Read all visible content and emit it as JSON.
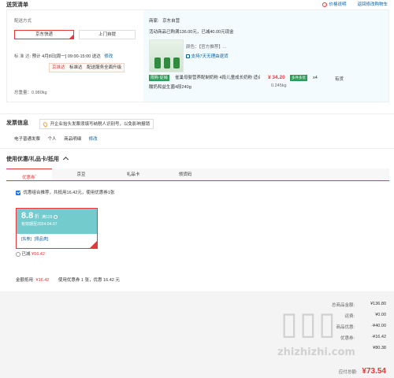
{
  "header": {
    "title": "送货清单",
    "links": [
      "价格说明",
      "返回修改购物车"
    ]
  },
  "delivery": {
    "method_label": "配送方式",
    "options": [
      "京东快递",
      "上门自提"
    ],
    "time_label": "标 准 达:",
    "time_value": "预计 4月8日[周一] 09:00-15:00 送达",
    "time_edit": "修改",
    "upgrade_badge": "京准达",
    "upgrade_text": "标准达",
    "upgrade_action": "配送服务全面升级",
    "weight_label": "总重量：",
    "weight_value": "0.980kg"
  },
  "merchant": {
    "label": "商家:",
    "name": "京东自营",
    "promo": "活动商品已购满136.00元，已减40.00元现金",
    "color_label": "颜色：",
    "color_value": "【官方推荐】...",
    "service": "支持7天无理由退货",
    "tag": "限购·促销",
    "product_name": "雀巢母婴营养配制奶粉 4段儿童成长奶粉 适合3-6岁 800g*4罐",
    "product_desc": "酸奶和益生菌4段240g",
    "price": "¥ 34.20",
    "price_tag": "多件多优",
    "qty": "x4",
    "stock": "有货",
    "weight": "0.245kg"
  },
  "invoice": {
    "title": "发票信息",
    "tip": "开企业抬头发票须填写纳税人识别号，以免影响报销",
    "type": "电子普通发票",
    "person": "个人",
    "detail": "商品明细",
    "edit": "修改"
  },
  "coupon_section": {
    "title": "使用优惠/礼品卡/抵用",
    "tabs": [
      "优惠券",
      "京豆",
      "礼品卡",
      "领货码"
    ],
    "recommend": "优惠组合推荐，共抵用16.42元，使用优惠券1张",
    "coupon": {
      "amount": "8.8",
      "unit": "折",
      "condition": "满129",
      "validity": "有效期至2024-04-07",
      "tags": [
        "[东券]",
        "[限品类]"
      ]
    },
    "used_label": "已减",
    "used_value": "¥16.42",
    "total_label": "金额抵用",
    "total_value": "¥16.42",
    "total_desc": "使用优惠券 1 张，优惠 16.42 元"
  },
  "summary": {
    "rows": [
      {
        "k": "总商品金额:",
        "v": "¥136.80"
      },
      {
        "k": "运费:",
        "v": "¥0.00"
      },
      {
        "k": "商品优惠:",
        "v": "-¥40.00"
      },
      {
        "k": "优惠券:",
        "v": "-¥16.42"
      },
      {
        "k": "",
        "v": "¥80.38"
      }
    ],
    "pay_label": "应付总额:",
    "pay_value": "¥73.54"
  },
  "watermark": "zhizhizhi.com",
  "colors": {
    "accent": "#e4393c",
    "link": "#005ea7",
    "coupon": "#74cbcd"
  }
}
